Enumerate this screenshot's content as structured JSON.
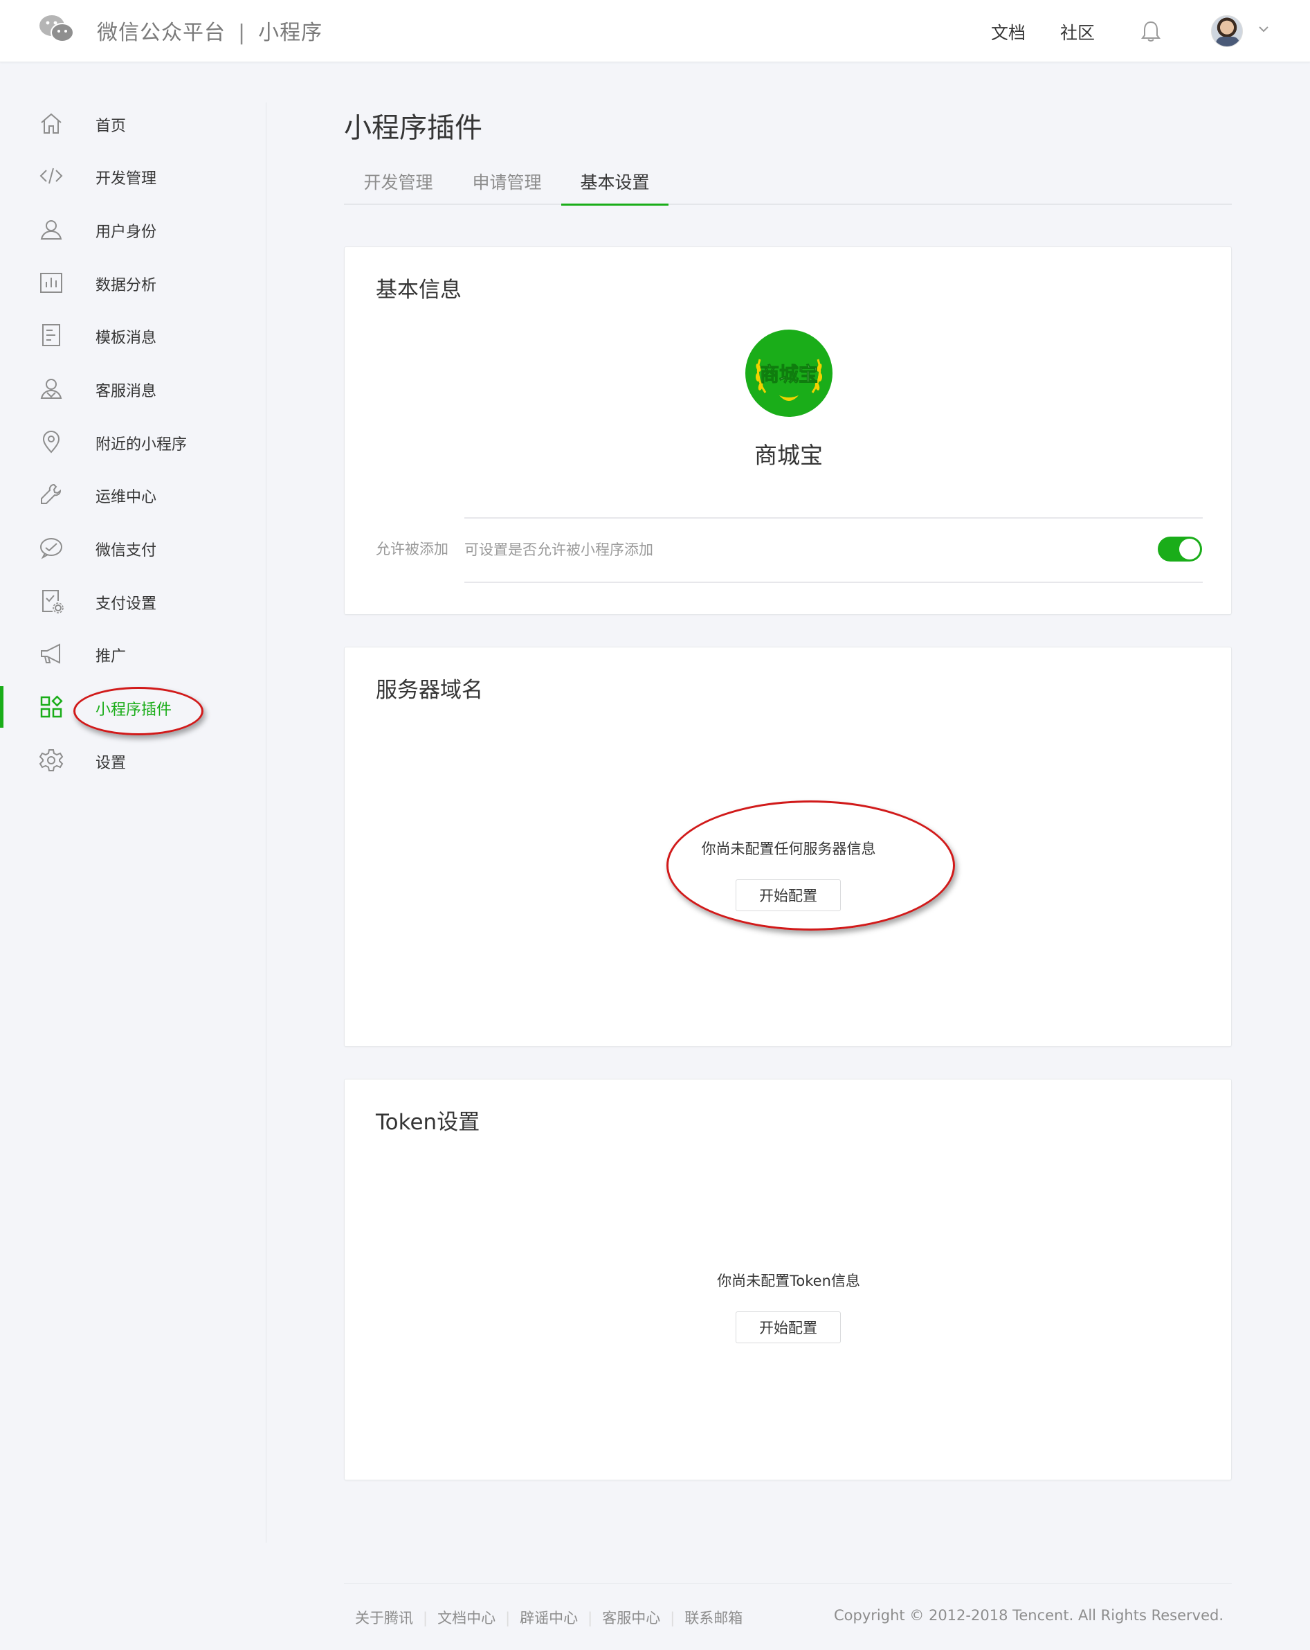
{
  "header": {
    "brand": "微信公众平台",
    "separator": "|",
    "product": "小程序",
    "links": [
      "文档",
      "社区"
    ]
  },
  "sidebar": {
    "items": [
      {
        "label": "首页",
        "icon": "home-icon"
      },
      {
        "label": "开发管理",
        "icon": "code-icon"
      },
      {
        "label": "用户身份",
        "icon": "user-icon"
      },
      {
        "label": "数据分析",
        "icon": "chart-icon"
      },
      {
        "label": "模板消息",
        "icon": "document-icon"
      },
      {
        "label": "客服消息",
        "icon": "service-icon"
      },
      {
        "label": "附近的小程序",
        "icon": "location-icon"
      },
      {
        "label": "运维中心",
        "icon": "wrench-icon"
      },
      {
        "label": "微信支付",
        "icon": "wechat-pay-icon"
      },
      {
        "label": "支付设置",
        "icon": "payment-settings-icon"
      },
      {
        "label": "推广",
        "icon": "megaphone-icon"
      },
      {
        "label": "小程序插件",
        "icon": "plugin-grid-icon",
        "active": true
      },
      {
        "label": "设置",
        "icon": "gear-icon"
      }
    ]
  },
  "main": {
    "title": "小程序插件",
    "tabs": [
      {
        "label": "开发管理"
      },
      {
        "label": "申请管理"
      },
      {
        "label": "基本设置",
        "active": true
      }
    ],
    "basic_info": {
      "title": "基本信息",
      "plugin_logo_text": "商城宝",
      "plugin_name": "商城宝",
      "setting_label": "允许被添加",
      "setting_desc": "可设置是否允许被小程序添加",
      "toggle_on": true
    },
    "server_domain": {
      "title": "服务器域名",
      "empty_text": "你尚未配置任何服务器信息",
      "button": "开始配置"
    },
    "token": {
      "title": "Token设置",
      "empty_text": "你尚未配置Token信息",
      "button": "开始配置"
    }
  },
  "footer": {
    "links": [
      "关于腾讯",
      "文档中心",
      "辟谣中心",
      "客服中心",
      "联系邮箱"
    ],
    "copyright": "Copyright © 2012-2018 Tencent. All Rights Reserved."
  },
  "colors": {
    "accent": "#1aad19",
    "annotation_ring": "#d11a1a",
    "background": "#f4f5f9"
  }
}
